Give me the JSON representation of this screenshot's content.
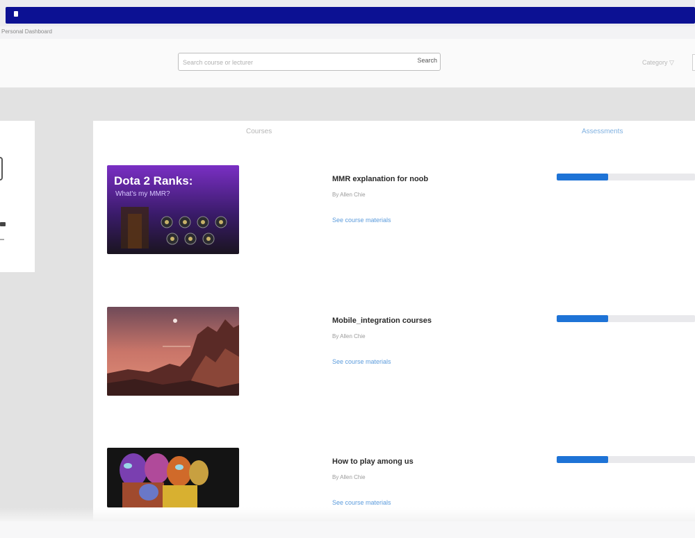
{
  "window": {
    "breadcrumb": "Personal Dashboard"
  },
  "header": {
    "search_placeholder": "Search course or lecturer",
    "search_button": "Search",
    "category_label": "Category ▽"
  },
  "tabs": [
    {
      "label": "Courses",
      "active": false
    },
    {
      "label": "Assessments",
      "active": true
    }
  ],
  "courses": [
    {
      "title": "MMR explanation for noob",
      "author": "By Allen Chie",
      "link": "See course materials",
      "progress": 0.37,
      "thumbnail": {
        "icon": "dota-ranks-thumbnail",
        "text_line1": "Dota 2 Ranks:",
        "text_line2": "What's my MMR?"
      }
    },
    {
      "title": "Mobile_integration courses",
      "author": "By Allen Chie",
      "link": "See course materials",
      "progress": 0.37,
      "thumbnail": {
        "icon": "sunset-mountain-thumbnail"
      }
    },
    {
      "title": "How to play among us",
      "author": "By Allen Chie",
      "link": "See course materials",
      "progress": 0.37,
      "thumbnail": {
        "icon": "among-us-characters-thumbnail"
      }
    }
  ],
  "colors": {
    "title_bar": "#0c1193",
    "progress_fill": "#1e73d6",
    "progress_track": "#e9e9ec",
    "link": "#5b9bdc",
    "active_tab": "#7fb0e0"
  }
}
